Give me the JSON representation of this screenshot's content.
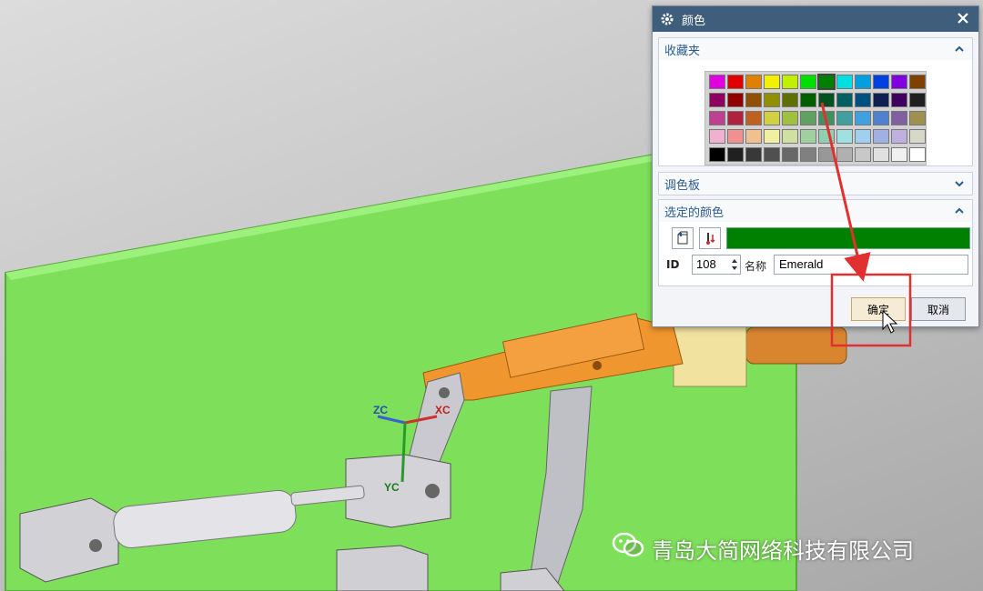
{
  "scene": {
    "axes": {
      "zc": "ZC",
      "xc": "XC",
      "yc": "YC"
    },
    "colors": {
      "plate": "#7ee05a",
      "arm": "#f09a30",
      "metal": "#d8d8dc"
    }
  },
  "dialog": {
    "title": "颜色",
    "favorites_label": "收藏夹",
    "palette_label": "调色板",
    "selected_label": "选定的颜色",
    "palette": [
      [
        "#e000e0",
        "#e00000",
        "#e08000",
        "#f0f000",
        "#c0f000",
        "#00e000",
        "#008000",
        "#00e0e0",
        "#00a0e0",
        "#0040e0",
        "#8000e0",
        "#804000"
      ],
      [
        "#900060",
        "#900000",
        "#905000",
        "#909000",
        "#607000",
        "#006000",
        "#005020",
        "#006060",
        "#005080",
        "#102050",
        "#400060",
        "#202020"
      ],
      [
        "#c04090",
        "#b02040",
        "#c06020",
        "#d0d040",
        "#a0c040",
        "#60a060",
        "#409060",
        "#40a0a0",
        "#40a0e0",
        "#5080d0",
        "#8060a0",
        "#a09050"
      ],
      [
        "#f0b0d0",
        "#f09090",
        "#f0c090",
        "#f0f0a0",
        "#d0e0a0",
        "#a0d0a0",
        "#90d0b0",
        "#a0e0e0",
        "#a0d0f0",
        "#a0b0e0",
        "#c0b0e0",
        "#d8d8c8"
      ],
      [
        "#000000",
        "#202020",
        "#383838",
        "#505050",
        "#686868",
        "#808080",
        "#989898",
        "#b0b0b0",
        "#c8c8c8",
        "#e0e0e0",
        "#f0f0f0",
        "#ffffff"
      ]
    ],
    "selected_swatch": {
      "row": 0,
      "col": 6
    },
    "selected_color": "#008000",
    "id_label": "ID",
    "id_value": "108",
    "name_label": "名称",
    "name_value": "Emerald",
    "ok_label": "确定",
    "cancel_label": "取消"
  },
  "watermark": {
    "text": "青岛大简网络科技有限公司"
  },
  "annotation": {
    "color": "#e03030"
  }
}
